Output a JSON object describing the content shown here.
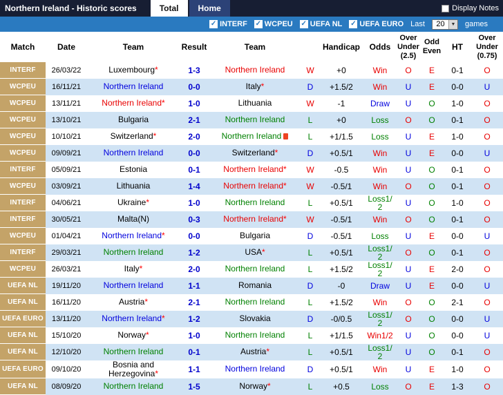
{
  "titlebar": {
    "title": "Northern Ireland - Historic scores",
    "tabs": [
      {
        "label": "Total",
        "active": true
      },
      {
        "label": "Home",
        "active": false
      }
    ],
    "display_notes_label": "Display Notes"
  },
  "filterbar": {
    "competitions": [
      {
        "label": "INTERF",
        "checked": true
      },
      {
        "label": "WCPEU",
        "checked": true
      },
      {
        "label": "UEFA NL",
        "checked": true
      },
      {
        "label": "UEFA EURO",
        "checked": true
      }
    ],
    "last_label": "Last",
    "games_count": "20",
    "games_label": "games"
  },
  "colors": {
    "topbar": "#171e33",
    "filterbar_blue": "#2a7ac0",
    "match_badge_tan": "#c4a368",
    "row_alt_blue": "#d0e3f4",
    "win_red": "#e80000",
    "draw_blue": "#0000dd",
    "loss_green": "#008000",
    "score_blue": "#0000cc"
  },
  "table": {
    "headers": {
      "match": "Match",
      "date": "Date",
      "team1": "Team",
      "result": "Result",
      "team2": "Team",
      "letter": "",
      "handicap": "Handicap",
      "odds": "Odds",
      "ou25": [
        "Over",
        "Under",
        "(2.5)"
      ],
      "oddeven": [
        "Odd",
        "Even"
      ],
      "ht": "HT",
      "ou075": [
        "Over",
        "Under",
        "(0.75)"
      ]
    },
    "rows": [
      {
        "match": "INTERF",
        "date": "26/03/22",
        "team1": "Luxembourg",
        "team1_class": "opp",
        "team1_star": true,
        "score": "1-3",
        "team2": "Northern Ireland",
        "team2_class": "res-w",
        "team2_star": false,
        "team2_redcard": false,
        "letter": "W",
        "letter_class": "res-w",
        "handicap": "+0",
        "odds": "Win",
        "odds_class": "res-w",
        "ou25": "O",
        "ou25_class": "ou-o",
        "oe": "E",
        "oe_class": "oe-e",
        "ht": "0-1",
        "ou075": "O",
        "ou075_class": "ou-o"
      },
      {
        "match": "WCPEU",
        "date": "16/11/21",
        "team1": "Northern Ireland",
        "team1_class": "res-d",
        "team1_star": false,
        "score": "0-0",
        "team2": "Italy",
        "team2_class": "opp",
        "team2_star": true,
        "team2_redcard": false,
        "letter": "D",
        "letter_class": "res-d",
        "handicap": "+1.5/2",
        "odds": "Win",
        "odds_class": "res-w",
        "ou25": "U",
        "ou25_class": "ou-u",
        "oe": "E",
        "oe_class": "oe-e",
        "ht": "0-0",
        "ou075": "U",
        "ou075_class": "ou-u"
      },
      {
        "match": "WCPEU",
        "date": "13/11/21",
        "team1": "Northern Ireland",
        "team1_class": "res-w",
        "team1_star": true,
        "score": "1-0",
        "team2": "Lithuania",
        "team2_class": "opp",
        "team2_star": false,
        "team2_redcard": false,
        "letter": "W",
        "letter_class": "res-w",
        "handicap": "-1",
        "odds": "Draw",
        "odds_class": "res-d",
        "ou25": "U",
        "ou25_class": "ou-u",
        "oe": "O",
        "oe_class": "oe-o",
        "ht": "1-0",
        "ou075": "O",
        "ou075_class": "ou-o"
      },
      {
        "match": "WCPEU",
        "date": "13/10/21",
        "team1": "Bulgaria",
        "team1_class": "opp",
        "team1_star": false,
        "score": "2-1",
        "team2": "Northern Ireland",
        "team2_class": "res-l",
        "team2_star": false,
        "team2_redcard": false,
        "letter": "L",
        "letter_class": "res-l",
        "handicap": "+0",
        "odds": "Loss",
        "odds_class": "res-l",
        "ou25": "O",
        "ou25_class": "ou-o",
        "oe": "O",
        "oe_class": "oe-o",
        "ht": "0-1",
        "ou075": "O",
        "ou075_class": "ou-o"
      },
      {
        "match": "WCPEU",
        "date": "10/10/21",
        "team1": "Switzerland",
        "team1_class": "opp",
        "team1_star": true,
        "score": "2-0",
        "team2": "Northern Ireland",
        "team2_class": "res-l",
        "team2_star": false,
        "team2_redcard": true,
        "letter": "L",
        "letter_class": "res-l",
        "handicap": "+1/1.5",
        "odds": "Loss",
        "odds_class": "res-l",
        "ou25": "U",
        "ou25_class": "ou-u",
        "oe": "E",
        "oe_class": "oe-e",
        "ht": "1-0",
        "ou075": "O",
        "ou075_class": "ou-o"
      },
      {
        "match": "WCPEU",
        "date": "09/09/21",
        "team1": "Northern Ireland",
        "team1_class": "res-d",
        "team1_star": false,
        "score": "0-0",
        "team2": "Switzerland",
        "team2_class": "opp",
        "team2_star": true,
        "team2_redcard": false,
        "letter": "D",
        "letter_class": "res-d",
        "handicap": "+0.5/1",
        "odds": "Win",
        "odds_class": "res-w",
        "ou25": "U",
        "ou25_class": "ou-u",
        "oe": "E",
        "oe_class": "oe-e",
        "ht": "0-0",
        "ou075": "U",
        "ou075_class": "ou-u"
      },
      {
        "match": "INTERF",
        "date": "05/09/21",
        "team1": "Estonia",
        "team1_class": "opp",
        "team1_star": false,
        "score": "0-1",
        "team2": "Northern Ireland",
        "team2_class": "res-w",
        "team2_star": true,
        "team2_redcard": false,
        "letter": "W",
        "letter_class": "res-w",
        "handicap": "-0.5",
        "odds": "Win",
        "odds_class": "res-w",
        "ou25": "U",
        "ou25_class": "ou-u",
        "oe": "O",
        "oe_class": "oe-o",
        "ht": "0-1",
        "ou075": "O",
        "ou075_class": "ou-o"
      },
      {
        "match": "WCPEU",
        "date": "03/09/21",
        "team1": "Lithuania",
        "team1_class": "opp",
        "team1_star": false,
        "score": "1-4",
        "team2": "Northern Ireland",
        "team2_class": "res-w",
        "team2_star": true,
        "team2_redcard": false,
        "letter": "W",
        "letter_class": "res-w",
        "handicap": "-0.5/1",
        "odds": "Win",
        "odds_class": "res-w",
        "ou25": "O",
        "ou25_class": "ou-o",
        "oe": "O",
        "oe_class": "oe-o",
        "ht": "0-1",
        "ou075": "O",
        "ou075_class": "ou-o"
      },
      {
        "match": "INTERF",
        "date": "04/06/21",
        "team1": "Ukraine",
        "team1_class": "opp",
        "team1_star": true,
        "score": "1-0",
        "team2": "Northern Ireland",
        "team2_class": "res-l",
        "team2_star": false,
        "team2_redcard": false,
        "letter": "L",
        "letter_class": "res-l",
        "handicap": "+0.5/1",
        "odds": "Loss1/2",
        "odds_class": "res-l",
        "ou25": "U",
        "ou25_class": "ou-u",
        "oe": "O",
        "oe_class": "oe-o",
        "ht": "1-0",
        "ou075": "O",
        "ou075_class": "ou-o"
      },
      {
        "match": "INTERF",
        "date": "30/05/21",
        "team1": "Malta(N)",
        "team1_class": "opp",
        "team1_star": false,
        "score": "0-3",
        "team2": "Northern Ireland",
        "team2_class": "res-w",
        "team2_star": true,
        "team2_redcard": false,
        "letter": "W",
        "letter_class": "res-w",
        "handicap": "-0.5/1",
        "odds": "Win",
        "odds_class": "res-w",
        "ou25": "O",
        "ou25_class": "ou-o",
        "oe": "O",
        "oe_class": "oe-o",
        "ht": "0-1",
        "ou075": "O",
        "ou075_class": "ou-o"
      },
      {
        "match": "WCPEU",
        "date": "01/04/21",
        "team1": "Northern Ireland",
        "team1_class": "res-d",
        "team1_star": true,
        "score": "0-0",
        "team2": "Bulgaria",
        "team2_class": "opp",
        "team2_star": false,
        "team2_redcard": false,
        "letter": "D",
        "letter_class": "res-d",
        "handicap": "-0.5/1",
        "odds": "Loss",
        "odds_class": "res-l",
        "ou25": "U",
        "ou25_class": "ou-u",
        "oe": "E",
        "oe_class": "oe-e",
        "ht": "0-0",
        "ou075": "U",
        "ou075_class": "ou-u"
      },
      {
        "match": "INTERF",
        "date": "29/03/21",
        "team1": "Northern Ireland",
        "team1_class": "res-l",
        "team1_star": false,
        "score": "1-2",
        "team2": "USA",
        "team2_class": "opp",
        "team2_star": true,
        "team2_redcard": false,
        "letter": "L",
        "letter_class": "res-l",
        "handicap": "+0.5/1",
        "odds": "Loss1/2",
        "odds_class": "res-l",
        "ou25": "O",
        "ou25_class": "ou-o",
        "oe": "O",
        "oe_class": "oe-o",
        "ht": "0-1",
        "ou075": "O",
        "ou075_class": "ou-o"
      },
      {
        "match": "WCPEU",
        "date": "26/03/21",
        "team1": "Italy",
        "team1_class": "opp",
        "team1_star": true,
        "score": "2-0",
        "team2": "Northern Ireland",
        "team2_class": "res-l",
        "team2_star": false,
        "team2_redcard": false,
        "letter": "L",
        "letter_class": "res-l",
        "handicap": "+1.5/2",
        "odds": "Loss1/2",
        "odds_class": "res-l",
        "ou25": "U",
        "ou25_class": "ou-u",
        "oe": "E",
        "oe_class": "oe-e",
        "ht": "2-0",
        "ou075": "O",
        "ou075_class": "ou-o"
      },
      {
        "match": "UEFA NL",
        "date": "19/11/20",
        "team1": "Northern Ireland",
        "team1_class": "res-d",
        "team1_star": false,
        "score": "1-1",
        "team2": "Romania",
        "team2_class": "opp",
        "team2_star": false,
        "team2_redcard": false,
        "letter": "D",
        "letter_class": "res-d",
        "handicap": "-0",
        "odds": "Draw",
        "odds_class": "res-d",
        "ou25": "U",
        "ou25_class": "ou-u",
        "oe": "E",
        "oe_class": "oe-e",
        "ht": "0-0",
        "ou075": "U",
        "ou075_class": "ou-u"
      },
      {
        "match": "UEFA NL",
        "date": "16/11/20",
        "team1": "Austria",
        "team1_class": "opp",
        "team1_star": true,
        "score": "2-1",
        "team2": "Northern Ireland",
        "team2_class": "res-l",
        "team2_star": false,
        "team2_redcard": false,
        "letter": "L",
        "letter_class": "res-l",
        "handicap": "+1.5/2",
        "odds": "Win",
        "odds_class": "res-w",
        "ou25": "O",
        "ou25_class": "ou-o",
        "oe": "O",
        "oe_class": "oe-o",
        "ht": "2-1",
        "ou075": "O",
        "ou075_class": "ou-o"
      },
      {
        "match": "UEFA EURO",
        "date": "13/11/20",
        "team1": "Northern Ireland",
        "team1_class": "res-d",
        "team1_star": true,
        "score": "1-2",
        "team2": "Slovakia",
        "team2_class": "opp",
        "team2_star": false,
        "team2_redcard": false,
        "letter": "D",
        "letter_class": "res-d",
        "handicap": "-0/0.5",
        "odds": "Loss1/2",
        "odds_class": "res-l",
        "ou25": "O",
        "ou25_class": "ou-o",
        "oe": "O",
        "oe_class": "oe-o",
        "ht": "0-0",
        "ou075": "U",
        "ou075_class": "ou-u"
      },
      {
        "match": "UEFA NL",
        "date": "15/10/20",
        "team1": "Norway",
        "team1_class": "opp",
        "team1_star": true,
        "score": "1-0",
        "team2": "Northern Ireland",
        "team2_class": "res-l",
        "team2_star": false,
        "team2_redcard": false,
        "letter": "L",
        "letter_class": "res-l",
        "handicap": "+1/1.5",
        "odds": "Win1/2",
        "odds_class": "res-w",
        "ou25": "U",
        "ou25_class": "ou-u",
        "oe": "O",
        "oe_class": "oe-o",
        "ht": "0-0",
        "ou075": "U",
        "ou075_class": "ou-u"
      },
      {
        "match": "UEFA NL",
        "date": "12/10/20",
        "team1": "Northern Ireland",
        "team1_class": "res-l",
        "team1_star": false,
        "score": "0-1",
        "team2": "Austria",
        "team2_class": "opp",
        "team2_star": true,
        "team2_redcard": false,
        "letter": "L",
        "letter_class": "res-l",
        "handicap": "+0.5/1",
        "odds": "Loss1/2",
        "odds_class": "res-l",
        "ou25": "U",
        "ou25_class": "ou-u",
        "oe": "O",
        "oe_class": "oe-o",
        "ht": "0-1",
        "ou075": "O",
        "ou075_class": "ou-o"
      },
      {
        "match": "UEFA EURO",
        "date": "09/10/20",
        "team1": "Bosnia and Herzegovina",
        "team1_class": "opp",
        "team1_star": true,
        "score": "1-1",
        "team2": "Northern Ireland",
        "team2_class": "res-d",
        "team2_star": false,
        "team2_redcard": false,
        "letter": "D",
        "letter_class": "res-d",
        "handicap": "+0.5/1",
        "odds": "Win",
        "odds_class": "res-w",
        "ou25": "U",
        "ou25_class": "ou-u",
        "oe": "E",
        "oe_class": "oe-e",
        "ht": "1-0",
        "ou075": "O",
        "ou075_class": "ou-o"
      },
      {
        "match": "UEFA NL",
        "date": "08/09/20",
        "team1": "Northern Ireland",
        "team1_class": "res-l",
        "team1_star": false,
        "score": "1-5",
        "team2": "Norway",
        "team2_class": "opp",
        "team2_star": true,
        "team2_redcard": false,
        "letter": "L",
        "letter_class": "res-l",
        "handicap": "+0.5",
        "odds": "Loss",
        "odds_class": "res-l",
        "ou25": "O",
        "ou25_class": "ou-o",
        "oe": "E",
        "oe_class": "oe-e",
        "ht": "1-3",
        "ou075": "O",
        "ou075_class": "ou-o"
      }
    ]
  }
}
